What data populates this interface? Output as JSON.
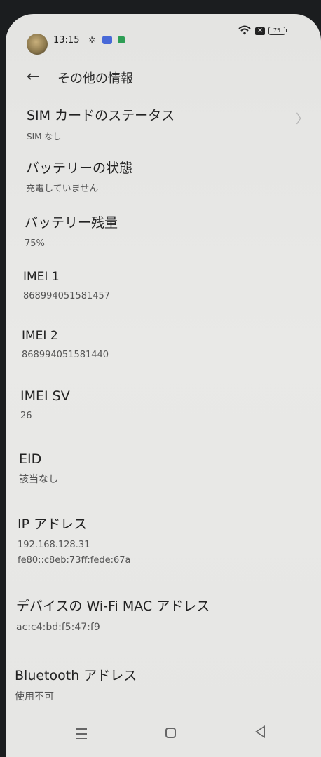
{
  "status_bar": {
    "time": "13:15",
    "battery": "75",
    "sim_status_glyph": "✕",
    "icons": [
      "avatar",
      "gear-icon",
      "app-icon",
      "app-icon",
      "wifi-icon",
      "sim-icon",
      "battery-icon"
    ]
  },
  "header": {
    "back_glyph": "←",
    "title": "その他の情報"
  },
  "items": [
    {
      "title": "SIM カードのステータス",
      "value": "SIM なし"
    },
    {
      "title": "バッテリーの状態",
      "value": "充電していません"
    },
    {
      "title": "バッテリー残量",
      "value": "75%"
    },
    {
      "title": "IMEI 1",
      "value": "868994051581457"
    },
    {
      "title": "IMEI 2",
      "value": "868994051581440"
    },
    {
      "title": "IMEI SV",
      "value": "26"
    },
    {
      "title": "EID",
      "value": "該当なし"
    },
    {
      "title": "IP アドレス",
      "value": "192.168.128.31",
      "value2": "fe80::c8eb:73ff:fede:67a"
    },
    {
      "title": "デバイスの Wi-Fi MAC アドレス",
      "value": "ac:c4:bd:f5:47:f9"
    },
    {
      "title": "Bluetooth アドレス",
      "value": "使用不可"
    }
  ],
  "chevron_glyph": "〉",
  "gear_glyph": "✲",
  "navigation_bar": {
    "buttons": [
      "menu-icon",
      "home-icon",
      "back-icon"
    ]
  }
}
